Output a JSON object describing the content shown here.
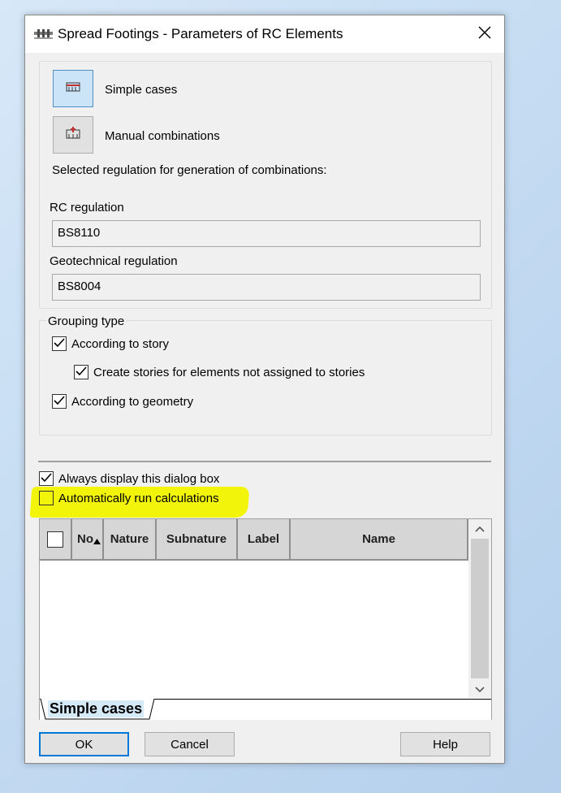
{
  "window": {
    "title": "Spread Footings - Parameters of RC Elements"
  },
  "actions": {
    "simple_cases": "Simple cases",
    "manual_combinations": "Manual combinations",
    "selected_regulation": "Selected regulation for generation of combinations:"
  },
  "regulations": {
    "rc_label": "RC regulation",
    "rc_value": "BS8110",
    "geo_label": "Geotechnical regulation",
    "geo_value": "BS8004"
  },
  "grouping": {
    "title": "Grouping type",
    "according_to_story": {
      "label": "According to story",
      "checked": true
    },
    "create_stories": {
      "label": "Create stories for elements not assigned to stories",
      "checked": true
    },
    "according_to_geometry": {
      "label": "According to geometry",
      "checked": true
    }
  },
  "options": {
    "always_display": {
      "label": "Always display this dialog box",
      "checked": true
    },
    "auto_run": {
      "label": "Automatically run calculations",
      "checked": false
    }
  },
  "grid": {
    "columns": [
      "No",
      "Nature",
      "Subnature",
      "Label",
      "Name"
    ],
    "rows": [],
    "tab": "Simple cases"
  },
  "buttons": {
    "ok": "OK",
    "cancel": "Cancel",
    "help": "Help"
  },
  "colors": {
    "highlight": "#f2f50a",
    "active_button": "#cce4f7",
    "accent": "#0078d7"
  },
  "icons": {
    "app": "beam-footing-icon",
    "close": "close-icon",
    "simple_cases": "simple-cases-icon",
    "manual_combinations": "manual-combinations-icon"
  }
}
